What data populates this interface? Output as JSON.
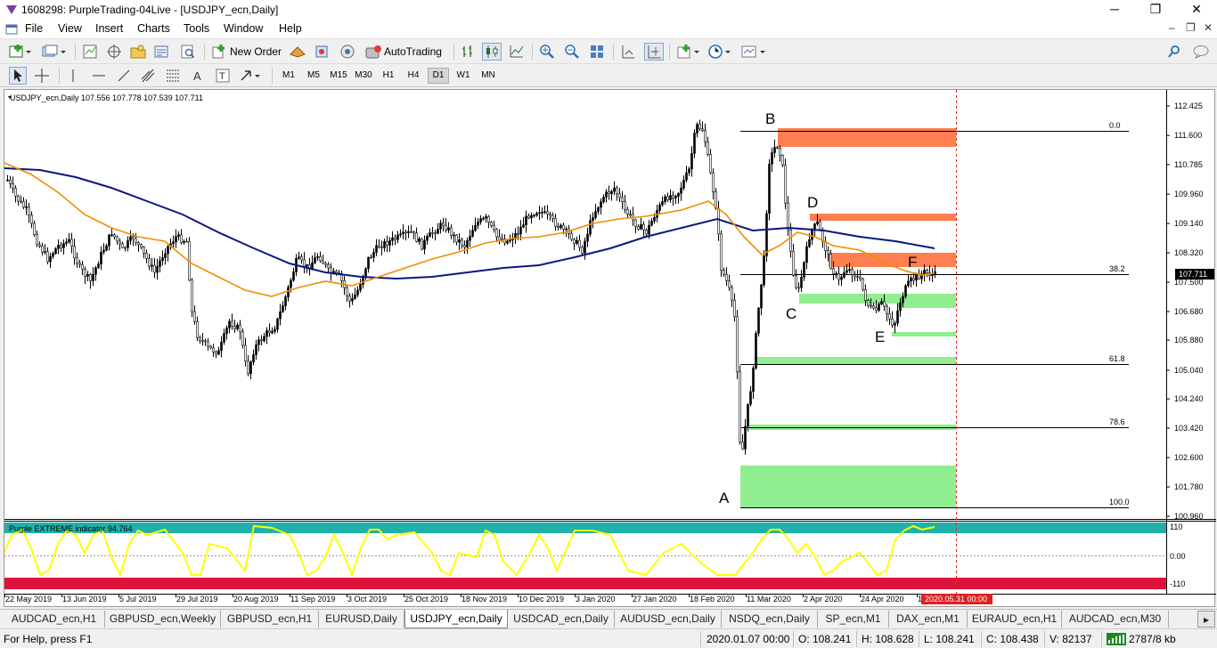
{
  "window": {
    "title": "1608298: PurpleTrading-04Live - [USDJPY_ecn,Daily]",
    "controls": [
      "─",
      "❐",
      "✕"
    ],
    "mdi_controls": [
      "–",
      "❐",
      "✕"
    ]
  },
  "menu": {
    "items": [
      "File",
      "View",
      "Insert",
      "Charts",
      "Tools",
      "Window",
      "Help"
    ]
  },
  "toolbar": {
    "new_order_label": "New Order",
    "autotrading_label": "AutoTrading"
  },
  "timeframes": {
    "items": [
      "M1",
      "M5",
      "M15",
      "M30",
      "H1",
      "H4",
      "D1",
      "W1",
      "MN"
    ],
    "selected": "D1"
  },
  "chart": {
    "symbol_header": "USDJPY_ecn,Daily  107.556 107.778 107.539 107.711",
    "current_price_label": "107.711",
    "indicator_label": "Purple EXTREME indicator 94.764",
    "price_ticks": [
      "112.425",
      "111.600",
      "110.785",
      "109.960",
      "109.140",
      "108.320",
      "107.500",
      "106.680",
      "105.880",
      "105.040",
      "104.240",
      "103.420",
      "102.600",
      "101.780",
      "100.960"
    ],
    "osc_ticks": [
      "110",
      "0.00",
      "-110"
    ],
    "date_ticks": [
      "22 May 2019",
      "13 Jun 2019",
      "5 Jul 2019",
      "29 Jul 2019",
      "20 Aug 2019",
      "11 Sep 2019",
      "3 Oct 2019",
      "25 Oct 2019",
      "18 Nov 2019",
      "10 Dec 2019",
      "3 Jan 2020",
      "27 Jan 2020",
      "18 Feb 2020",
      "11 Mar 2020",
      "2 Apr 2020",
      "24 Apr 2020",
      "1"
    ],
    "date_highlight": "2020.05.31 00:00",
    "fib_levels": [
      "0.0",
      "38.2",
      "61.8",
      "78.6",
      "100.0"
    ],
    "wave_labels": [
      "A",
      "B",
      "C",
      "D",
      "E",
      "F"
    ],
    "colors": {
      "bull": "#000000",
      "ma_fast": "#f28c00",
      "ma_slow": "#0b1680",
      "supply": "#ff7f50",
      "demand": "#90ee90",
      "osc_line": "#ffff00",
      "osc_top": "#20b2aa",
      "osc_bottom": "#dc143c"
    }
  },
  "tabs": {
    "items": [
      "AUDCAD_ecn,H1",
      "GBPUSD_ecn,Weekly",
      "GBPUSD_ecn,H1",
      "EURUSD,Daily",
      "USDJPY_ecn,Daily",
      "USDCAD_ecn,Daily",
      "AUDUSD_ecn,Daily",
      "NSDQ_ecn,Daily",
      "SP_ecn,M1",
      "DAX_ecn,M1",
      "EURAUD_ecn,H1",
      "AUDCAD_ecn,M30"
    ],
    "active": "USDJPY_ecn,Daily"
  },
  "status": {
    "help": "For Help, press F1",
    "datetime": "2020.01.07 00:00",
    "open": "O: 108.241",
    "high": "H: 108.628",
    "low": "L: 108.241",
    "close": "C: 108.438",
    "volume": "V: 82137",
    "traffic": "2787/8 kb"
  }
}
